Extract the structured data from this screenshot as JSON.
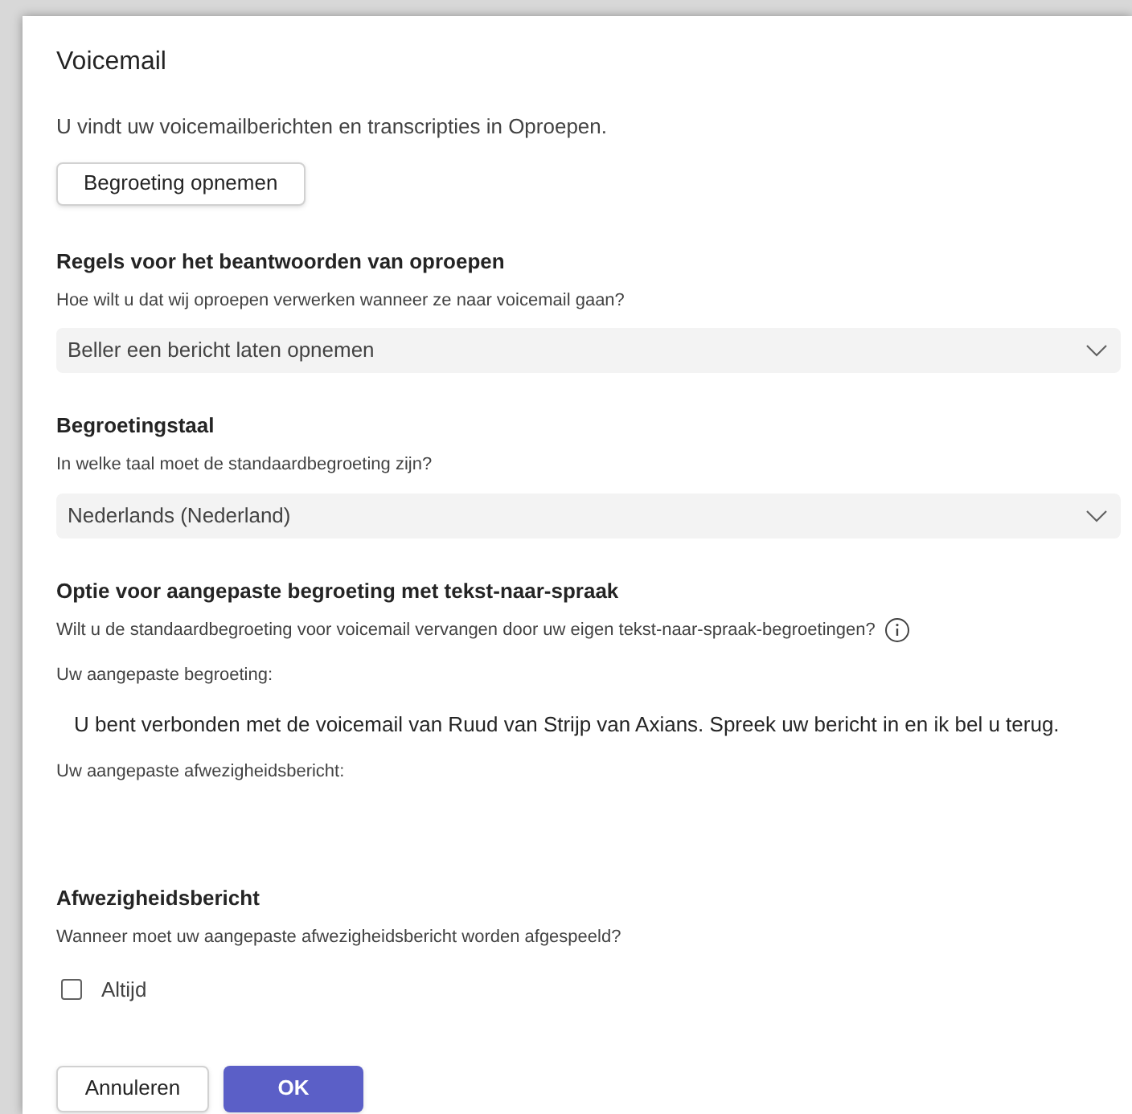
{
  "dialog": {
    "title": "Voicemail",
    "description": "U vindt uw voicemailberichten en transcripties in Oproepen.",
    "record_button": "Begroeting opnemen"
  },
  "answer_rules": {
    "heading": "Regels voor het beantwoorden van oproepen",
    "question": "Hoe wilt u dat wij oproepen verwerken wanneer ze naar voicemail gaan?",
    "value": "Beller een bericht laten opnemen"
  },
  "greeting_language": {
    "heading": "Begroetingstaal",
    "question": "In welke taal moet de standaardbegroeting zijn?",
    "value": "Nederlands (Nederland)"
  },
  "tts": {
    "heading": "Optie voor aangepaste begroeting met tekst-naar-spraak",
    "question": "Wilt u de standaardbegroeting voor voicemail vervangen door uw eigen tekst-naar-spraak-begroetingen?",
    "greeting_label": "Uw aangepaste begroeting:",
    "greeting_value": "U bent verbonden met de voicemail van Ruud van Strijp van Axians. Spreek uw bericht in en ik bel u terug.",
    "away_label": "Uw aangepaste afwezigheidsbericht:"
  },
  "away_message": {
    "heading": "Afwezigheidsbericht",
    "question": "Wanneer moet uw aangepaste afwezigheidsbericht worden afgespeeld?",
    "options": [
      {
        "label": "Altijd",
        "checked": false
      }
    ]
  },
  "buttons": [
    {
      "label": "Annuleren",
      "kind": "secondary"
    },
    {
      "label": "OK",
      "kind": "primary"
    }
  ]
}
